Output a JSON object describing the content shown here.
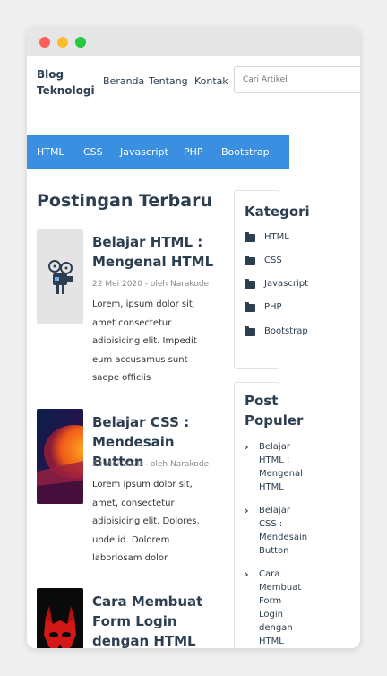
{
  "site": {
    "brand": "Blog Teknologi"
  },
  "topnav": [
    {
      "label": "Beranda"
    },
    {
      "label": "Tentang"
    },
    {
      "label": "Kontak"
    }
  ],
  "search": {
    "placeholder": "Cari Artikel"
  },
  "categories_bar": [
    {
      "label": "HTML"
    },
    {
      "label": "CSS"
    },
    {
      "label": "Javascript"
    },
    {
      "label": "PHP"
    },
    {
      "label": "Bootstrap"
    }
  ],
  "main": {
    "section_title": "Postingan Terbaru",
    "posts": [
      {
        "title": "Belajar HTML : Mengenal HTML",
        "meta": "22 Mei 2020 - oleh Narakode",
        "excerpt": "Lorem, ipsum dolor sit, amet consectetur adipisicing elit. Impedit eum accusamus sunt saepe officiis",
        "thumb_icon": "film-projector-icon"
      },
      {
        "title": "Belajar CSS : Mendesain Button",
        "meta": "22 Mei 2020 - oleh Narakode",
        "excerpt": "Lorem ipsum dolor sit, amet, consectetur adipisicing elit. Dolores, unde id. Dolorem laboriosam dolor",
        "thumb_icon": "abstract-gradient-image"
      },
      {
        "title": "Cara Membuat Form Login dengan HTML dan CSS",
        "meta": "",
        "excerpt": "",
        "thumb_icon": "red-mask-image"
      }
    ]
  },
  "sidebar": {
    "kategori_title": "Kategori",
    "kategori": [
      {
        "label": "HTML",
        "icon": "folder-icon"
      },
      {
        "label": "CSS",
        "icon": "folder-icon"
      },
      {
        "label": "Javascript",
        "icon": "folder-icon"
      },
      {
        "label": "PHP",
        "icon": "folder-icon"
      },
      {
        "label": "Bootstrap",
        "icon": "folder-icon"
      }
    ],
    "populer_title": "Post Populer",
    "populer": [
      {
        "label": "Belajar HTML : Mengenal HTML",
        "icon": "chevron-right-icon"
      },
      {
        "label": "Belajar CSS : Mendesain Button",
        "icon": "chevron-right-icon"
      },
      {
        "label": "Cara Membuat Form Login dengan HTML dan CSS",
        "icon": "chevron-right-icon"
      }
    ]
  },
  "colors": {
    "accent": "#3b8fe0",
    "text": "#2c3e50",
    "meta": "#8a8a8a"
  }
}
